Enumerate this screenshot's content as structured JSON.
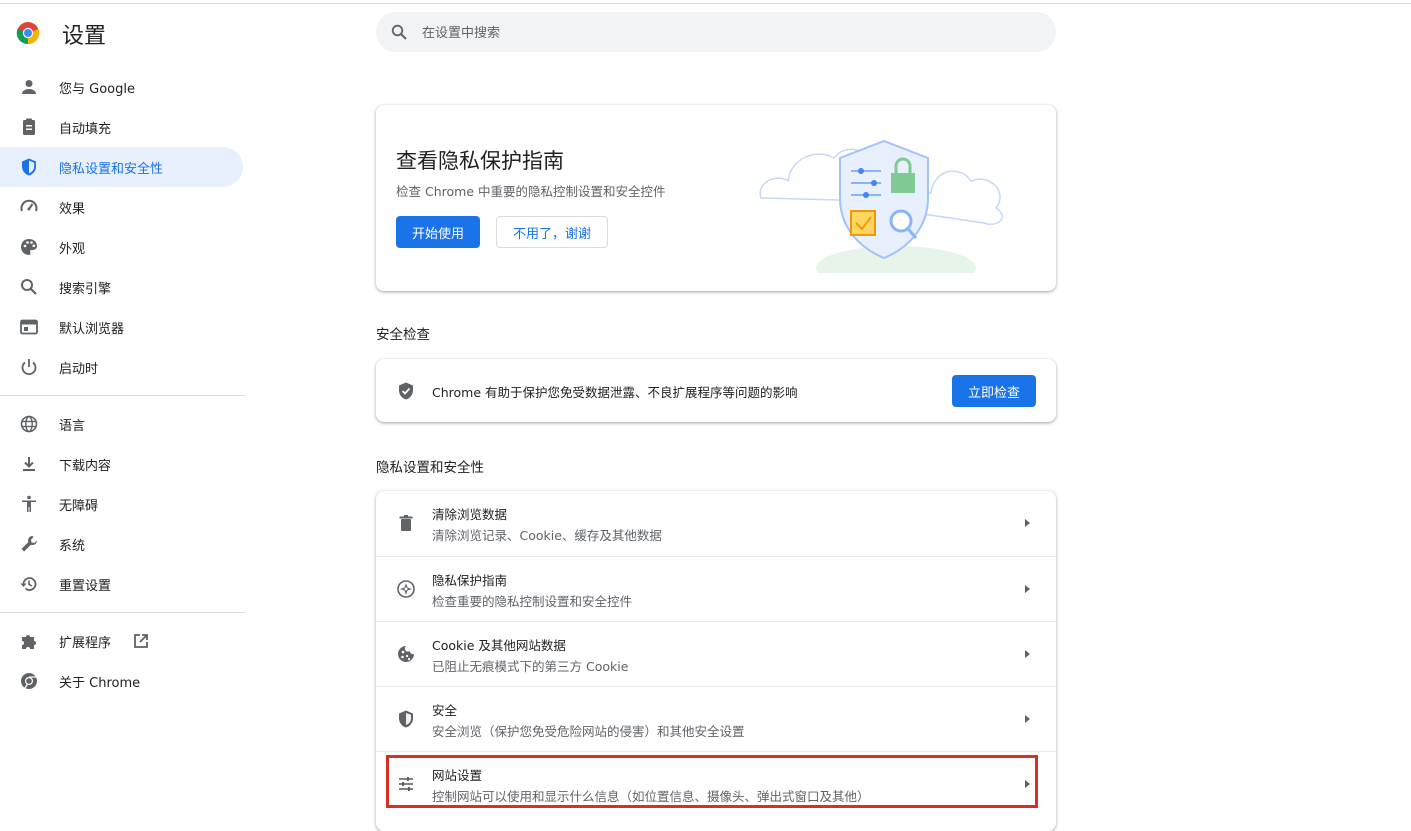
{
  "app": {
    "title": "设置"
  },
  "search": {
    "placeholder": "在设置中搜索"
  },
  "sidebar": {
    "items": [
      {
        "label": "您与 Google",
        "icon": "person-icon"
      },
      {
        "label": "自动填充",
        "icon": "clipboard-icon"
      },
      {
        "label": "隐私设置和安全性",
        "icon": "shield-icon",
        "active": true
      },
      {
        "label": "效果",
        "icon": "speedometer-icon"
      },
      {
        "label": "外观",
        "icon": "palette-icon"
      },
      {
        "label": "搜索引擎",
        "icon": "search-icon"
      },
      {
        "label": "默认浏览器",
        "icon": "browser-window-icon"
      },
      {
        "label": "启动时",
        "icon": "power-icon"
      }
    ],
    "items2": [
      {
        "label": "语言",
        "icon": "globe-icon"
      },
      {
        "label": "下载内容",
        "icon": "download-icon"
      },
      {
        "label": "无障碍",
        "icon": "accessibility-icon"
      },
      {
        "label": "系统",
        "icon": "wrench-icon"
      },
      {
        "label": "重置设置",
        "icon": "restore-icon"
      }
    ],
    "items3": [
      {
        "label": "扩展程序",
        "icon": "puzzle-icon"
      },
      {
        "label": "关于 Chrome",
        "icon": "chrome-icon"
      }
    ]
  },
  "promo": {
    "title": "查看隐私保护指南",
    "subtitle": "检查 Chrome 中重要的隐私控制设置和安全控件",
    "start_label": "开始使用",
    "dismiss_label": "不用了，谢谢"
  },
  "safety_check": {
    "heading": "安全检查",
    "text": "Chrome 有助于保护您免受数据泄露、不良扩展程序等问题的影响",
    "button_label": "立即检查"
  },
  "privacy": {
    "heading": "隐私设置和安全性",
    "rows": [
      {
        "title": "清除浏览数据",
        "subtitle": "清除浏览记录、Cookie、缓存及其他数据",
        "icon": "trash-icon"
      },
      {
        "title": "隐私保护指南",
        "subtitle": "检查重要的隐私控制设置和安全控件",
        "icon": "compass-icon"
      },
      {
        "title": "Cookie 及其他网站数据",
        "subtitle": "已阻止无痕模式下的第三方 Cookie",
        "icon": "cookie-icon"
      },
      {
        "title": "安全",
        "subtitle": "安全浏览（保护您免受危险网站的侵害）和其他安全设置",
        "icon": "security-shield-icon"
      },
      {
        "title": "网站设置",
        "subtitle": "控制网站可以使用和显示什么信息（如位置信息、摄像头、弹出式窗口及其他）",
        "icon": "tune-icon",
        "highlighted": true
      }
    ]
  },
  "colors": {
    "accent": "#1a73e8",
    "active_bg": "#e8f0fe",
    "highlight": "#d93025"
  }
}
